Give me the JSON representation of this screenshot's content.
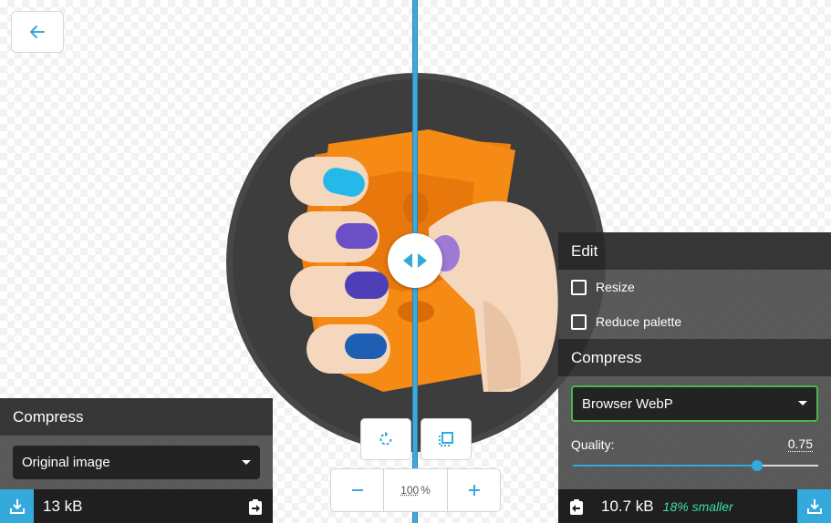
{
  "icons": {
    "back": "arrow-left-icon",
    "rotate": "rotate-icon",
    "background": "background-toggle-icon",
    "zoom_out": "minus-icon",
    "zoom_in": "plus-icon",
    "split_handle": "split-handle-icon",
    "download": "download-icon",
    "copy_across": "copy-across-icon"
  },
  "colors": {
    "accent": "#34a9dc",
    "select_active_border": "#4ab54a",
    "savings_text": "#3ddfa7"
  },
  "zoom": {
    "value": "100",
    "unit": "%"
  },
  "left_panel": {
    "title": "Compress",
    "method": "Original image",
    "file_size": "13 kB"
  },
  "right_panel": {
    "edit_title": "Edit",
    "options": [
      {
        "label": "Resize",
        "checked": false
      },
      {
        "label": "Reduce palette",
        "checked": false
      }
    ],
    "compress_title": "Compress",
    "method": "Browser WebP",
    "quality_label": "Quality:",
    "quality_value": "0.75",
    "quality_fraction": 0.75,
    "file_size": "10.7 kB",
    "savings": "18% smaller"
  }
}
